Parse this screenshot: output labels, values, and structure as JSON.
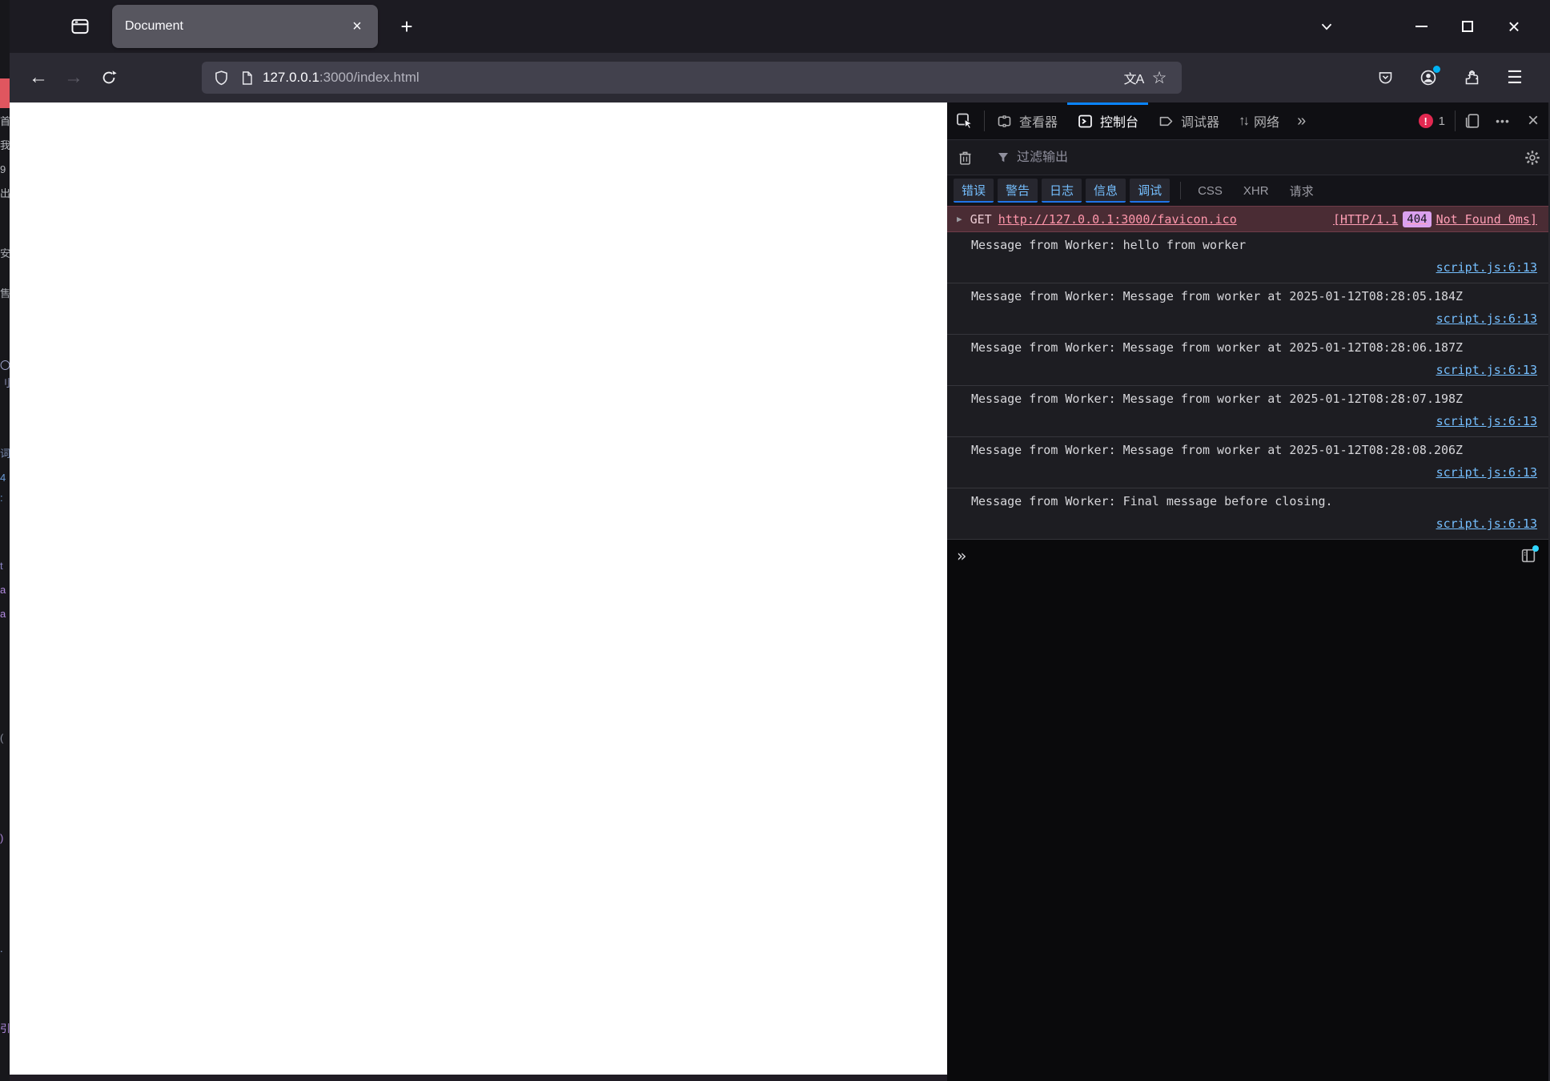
{
  "window": {
    "tab_title": "Document",
    "url_domain": "127.0.0.1",
    "url_path": ":3000/index.html"
  },
  "icons": {
    "new_tab": "+",
    "close_x": "×",
    "menu": "☰",
    "star": "☆",
    "translate": "文A",
    "network_arrows": "↑↓",
    "more_tabs": "»",
    "meatballs": "•••",
    "prompt": "»",
    "expand_triangle": "▶"
  },
  "colors": {
    "accent_blue": "#0a84ff",
    "link_blue": "#75bfff",
    "error_row_bg": "#4a2c34",
    "error_badge_red": "#e22850",
    "status_badge_purple": "#dba1ef",
    "notification_dot_cyan": "#30d6ff",
    "background_window_accent": "#e0565f"
  },
  "devtools": {
    "tabs": [
      {
        "label": "查看器"
      },
      {
        "label": "控制台"
      },
      {
        "label": "调试器"
      },
      {
        "label": "网络"
      }
    ],
    "error_count": "1",
    "filter_placeholder": "过滤输出",
    "filter_buttons": [
      "错误",
      "警告",
      "日志",
      "信息",
      "调试"
    ],
    "filter_types": [
      "CSS",
      "XHR",
      "请求"
    ],
    "network_error": {
      "method": "GET",
      "url": "http://127.0.0.1:3000/favicon.ico",
      "status_prefix": "[HTTP/1.1",
      "status_code": "404",
      "status_suffix": "Not Found 0ms]"
    },
    "messages": [
      {
        "text": "Message from Worker: hello from worker",
        "location": "script.js:6:13"
      },
      {
        "text": "Message from Worker: Message from worker at 2025-01-12T08:28:05.184Z",
        "location": "script.js:6:13"
      },
      {
        "text": "Message from Worker: Message from worker at 2025-01-12T08:28:06.187Z",
        "location": "script.js:6:13"
      },
      {
        "text": "Message from Worker: Message from worker at 2025-01-12T08:28:07.198Z",
        "location": "script.js:6:13"
      },
      {
        "text": "Message from Worker: Message from worker at 2025-01-12T08:28:08.206Z",
        "location": "script.js:6:13"
      },
      {
        "text": "Message from Worker: Final message before closing.",
        "location": "script.js:6:13"
      }
    ]
  }
}
